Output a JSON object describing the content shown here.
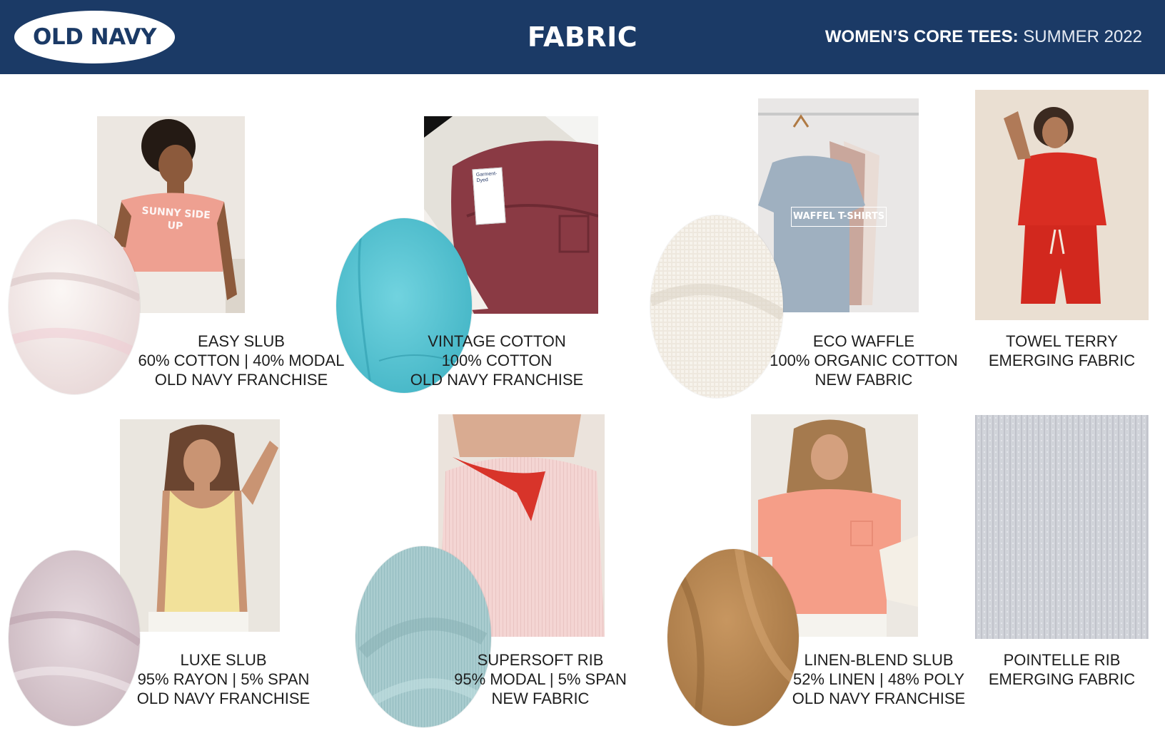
{
  "header": {
    "brand": "OLD NAVY",
    "title": "FABRIC",
    "category": "WOMEN’S CORE TEES:",
    "season": "SUMMER 2022"
  },
  "fabrics": [
    {
      "name": "EASY SLUB",
      "content": "60% COTTON | 40% MODAL",
      "status": "OLD NAVY FRANCHISE",
      "shirt_print": "SUNNY SIDE UP"
    },
    {
      "name": "VINTAGE COTTON",
      "content": "100% COTTON",
      "status": "OLD NAVY FRANCHISE",
      "tag_text": "Garment-Dyed"
    },
    {
      "name": "ECO WAFFLE",
      "content": "100% ORGANIC COTTON",
      "status": "NEW FABRIC",
      "photo_sign": "WAFFEL T-SHIRTS"
    },
    {
      "name": "TOWEL TERRY",
      "status": "EMERGING FABRIC"
    },
    {
      "name": "LUXE SLUB",
      "content": "95% RAYON | 5% SPAN",
      "status": "OLD NAVY FRANCHISE"
    },
    {
      "name": "SUPERSOFT RIB",
      "content": "95% MODAL | 5% SPAN",
      "status": "NEW FABRIC"
    },
    {
      "name": "LINEN-BLEND SLUB",
      "content": "52% LINEN | 48% POLY",
      "status": "OLD NAVY FRANCHISE"
    },
    {
      "name": "POINTELLE RIB",
      "status": "EMERGING FABRIC"
    }
  ],
  "colors": {
    "header_bg": "#1b3a66",
    "easy_slub_swatch": "#f1e6e6",
    "vintage_cotton_swatch": "#52c2d1",
    "eco_waffle_swatch": "#ece6dc",
    "towel_terry": "#d92d22",
    "luxe_slub_swatch": "#d9c5cd",
    "supersoft_rib_swatch": "#a9cccf",
    "linen_blend_swatch": "#b9874f",
    "pointelle_rib": "#c9ccd3"
  }
}
